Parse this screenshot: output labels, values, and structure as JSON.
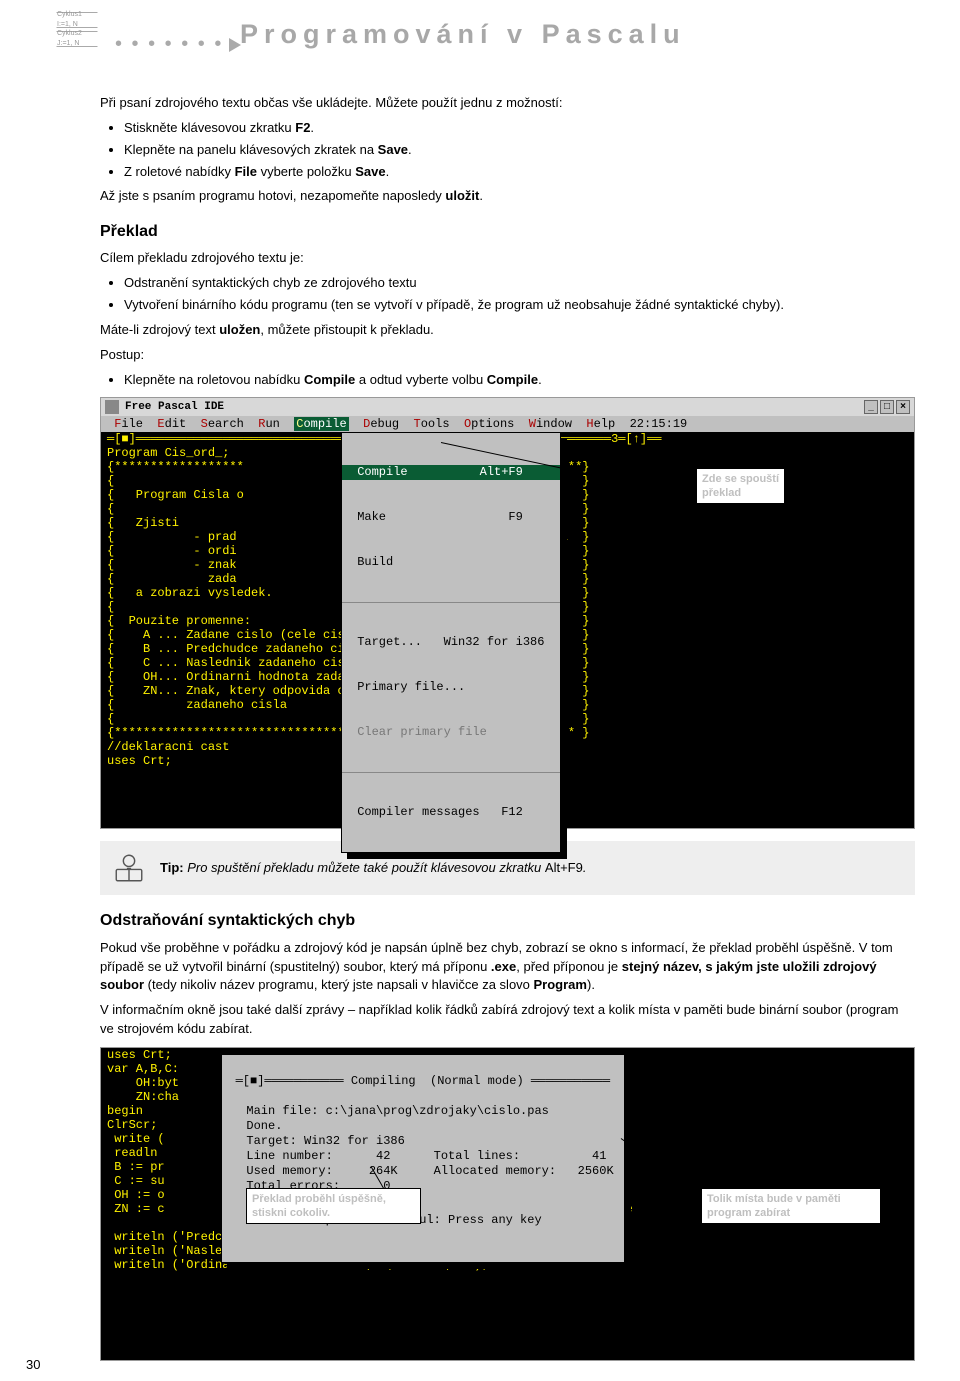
{
  "header": {
    "title": "Programování v Pascalu",
    "box1": "Cyklus1\nI:=1, N",
    "box2": "Cyklus2\nJ:=1, N"
  },
  "intro": {
    "p1": "Při psaní zdrojového textu občas vše ukládejte. Můžete použít jednu z možností:",
    "li1_a": "Stiskněte klávesovou zkratku ",
    "li1_b": "F2",
    "li1_c": ".",
    "li2_a": "Klepněte na panelu klávesových zkratek na ",
    "li2_b": "Save",
    "li2_c": ".",
    "li3_a": "Z roletové nabídky ",
    "li3_b": "File",
    "li3_c": " vyberte položku ",
    "li3_d": "Save",
    "li3_e": ".",
    "p2_a": "Až jste s psaním programu hotovi, nezapomeňte naposledy ",
    "p2_b": "uložit",
    "p2_c": "."
  },
  "preklad": {
    "h": "Překlad",
    "p1": "Cílem překladu zdrojového textu je:",
    "li1": "Odstranění syntaktických chyb ze zdrojového textu",
    "li2": "Vytvoření binárního kódu programu (ten se vytvoří v případě, že program už neobsahuje žádné syntaktické chyby).",
    "p2_a": "Máte-li zdrojový text ",
    "p2_b": "uložen",
    "p2_c": ", můžete přistoupit k překladu.",
    "p3": "Postup:",
    "li3_a": "Klepněte na roletovou nabídku ",
    "li3_b": "Compile",
    "li3_c": " a odtud vyberte volbu ",
    "li3_d": "Compile",
    "li3_e": "."
  },
  "ide1": {
    "title": "Free Pascal IDE",
    "menubar": {
      "file": "File",
      "edit": "Edit",
      "search": "Search",
      "run": "Run",
      "compile": "Compile",
      "debug": "Debug",
      "tools": "Tools",
      "options": "Options",
      "window": "Window",
      "help": "Help",
      "clock": "22:15:19"
    },
    "code": "═[■]══════════════════════════════════════════════════════════════════3═[↑]══\nProgram Cis_ord_;\n{******************                                          *****}\n{                                                                 }\n{   Program Cisla o                                               }\n{                                                                 }\n{   Zjisti                                                        }\n{           - prad                                             a  }\n{           - ordi                                                }\n{           - znak                                             u  }\n{             zada                                                }\n{   a zobrazi vysledek.                                           }\n{                                                                 }\n{  Pouzite promenne:                                              }\n{    A ... Zadane cislo (cele cislo)                              }\n{    B ... Predchudce zadaneho cisla                              }\n{    C ... Naslednik zadaneho cisla                               }\n{    OH... Ordinarni hodnota zadaneho cisla                       }\n{    ZN... Znak, ktery odpovida ordinarni hodnote                 }\n{          zadaneho cisla                                         }\n{                                                                 }\n{**************************************************************** }\n//deklaracni cast\nuses Crt;",
    "dropdown": {
      "compile": " Compile          Alt+F9 ",
      "make": " Make                 F9 ",
      "build": " Build                   ",
      "target": " Target...   Win32 for i386 ",
      "primary": " Primary file...         ",
      "clear": " Clear primary file      ",
      "messages": " Compiler messages   F12 "
    },
    "callout": "Zde se spouští\npřeklad"
  },
  "tip": {
    "label": "Tip:",
    "text": " Pro spuštění překladu můžete také použít klávesovou zkratku ",
    "shortcut": "Alt+F9",
    "end": "."
  },
  "section3": {
    "h": "Odstraňování syntaktických chyb",
    "p1_a": "Pokud vše proběhne v pořádku a zdrojový kód je napsán úplně bez chyb, zobrazí se okno s informací, že překlad proběhl úspěšně. V tom případě se už vytvořil binární (spustitelný) soubor, který má příponu ",
    "p1_b": ".exe",
    "p1_c": ", před příponou je ",
    "p1_d": "stejný název, s jakým jste uložili zdrojový soubor",
    "p1_e": " (tedy nikoliv název programu, který jste napsali v hlavičce za slovo ",
    "p1_f": "Program",
    "p1_g": ").",
    "p2": "V informačním okně jsou také další zprávy – například kolik řádků zabírá zdrojový text a kolik místa v paměti bude binární soubor (program ve strojovém kódu zabírat."
  },
  "ide2": {
    "bgcode": "uses Crt;\nvar A,B,C:\n    OH:byt\n    ZN:cha\nbegin\nClrScr;\n write (\n readln\n B := pr\n C := su\n OH := o\n ZN := c                                                           odnote\n\n writeln ('Predc                          je cislo ', B);\n writeln ('Nasle                        ', je cislo ', C);\n writeln ('Ordinarni hodnota cisla ', A, ' ie ', OH);",
    "dialog": {
      "title": "═[■]═══════════ Compiling  (Normal mode) ═══════════",
      "body": "  Main file: c:\\jana\\prog\\zdrojaky\\cislo.pas\n  Done.\n  Target: Win32 for i386\n  Line number:      42      Total lines:          41\n  Used memory:     264K     Allocated memory:   2560K\n  Total errors:      0\n",
      "success": "Compile successful: Press any key"
    },
    "calloutA": "Překlad proběhl úspěšně,\nstiskni cokoliv.",
    "calloutB": "Tolik místa bude v paměti\nprogram zabírat"
  },
  "pagenum": "30"
}
